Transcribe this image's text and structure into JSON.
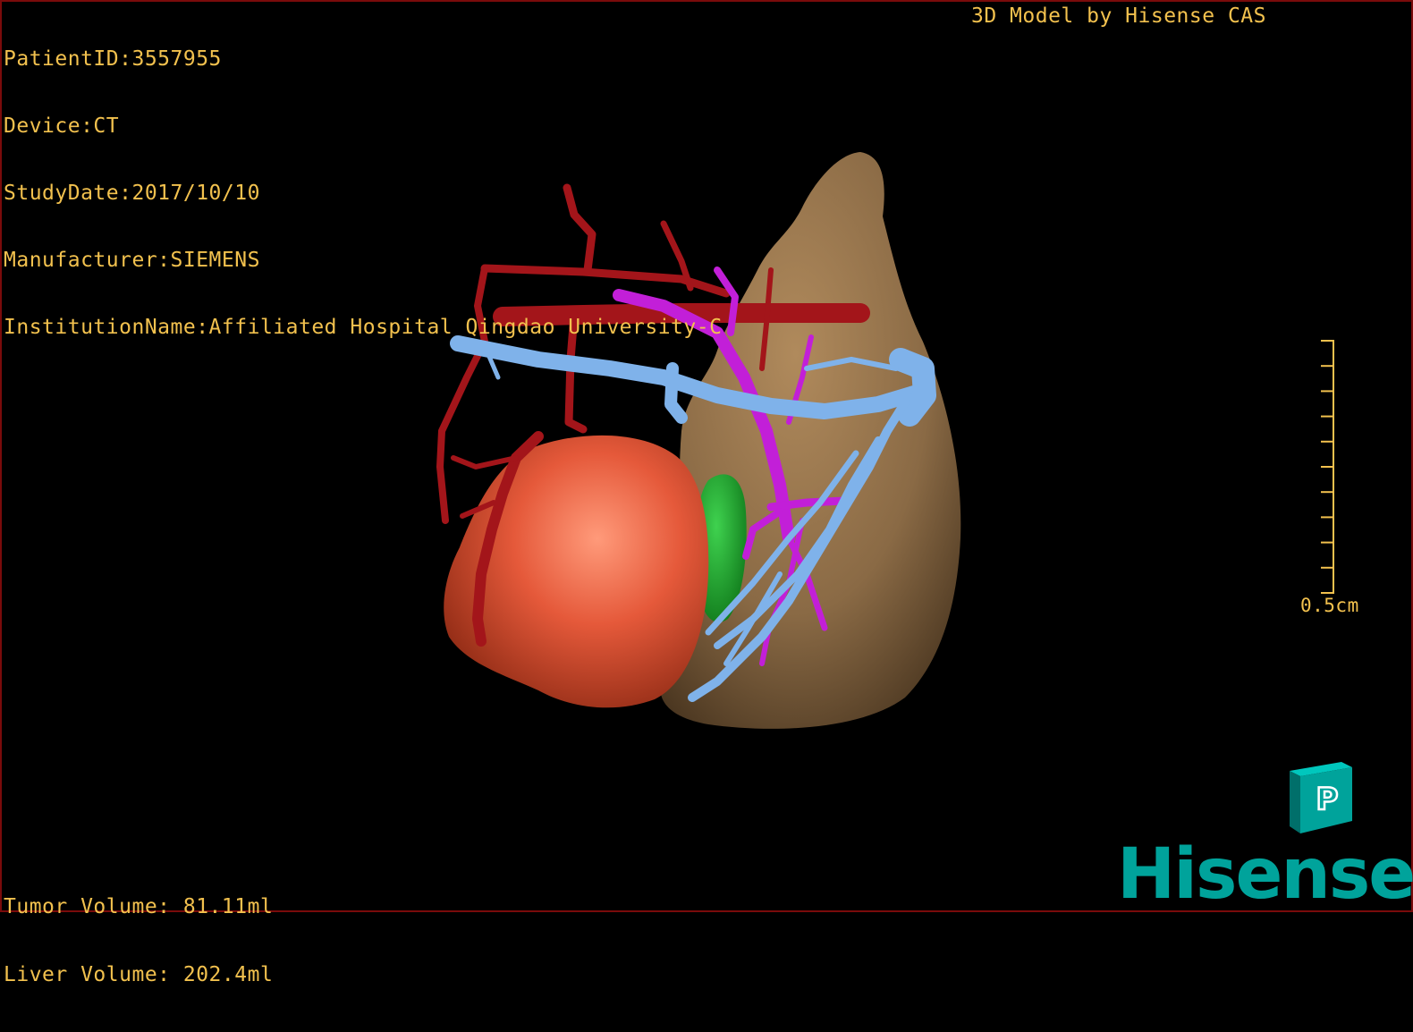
{
  "viewer": {
    "meta": {
      "patient_id": "PatientID:3557955",
      "device": "Device:CT",
      "study_date": "StudyDate:2017/10/10",
      "manufacturer": "Manufacturer:SIEMENS",
      "institution": "InstitutionName:Affiliated Hospital Qingdao University-C"
    },
    "credit": "3D Model by Hisense CAS",
    "volumes": {
      "tumor": "Tumor Volume: 81.11ml",
      "liver": "Liver Volume: 202.4ml"
    },
    "scale": {
      "label": "0.5cm",
      "tick_count": 11
    },
    "orientation_cube": {
      "face_label": "P",
      "color": "#00a39b"
    },
    "brand": "Hisense",
    "colors": {
      "overlay_text": "#f2c14e",
      "liver": "#8a6a45",
      "tumor": "#e5593a",
      "artery": "#a3151a",
      "portal_vein": "#c21fd8",
      "hepatic_vein": "#7fb2ea",
      "gallbladder": "#119a1f",
      "brand": "#00a39b",
      "frame": "#7a0b0b"
    },
    "structures": {
      "liver": "liver-model",
      "tumor": "tumor-model",
      "gallbladder": "gallbladder-model",
      "artery": "artery-tree",
      "portal_vein": "portal-vein-tree",
      "hepatic_vein": "hepatic-vein-tree"
    }
  }
}
